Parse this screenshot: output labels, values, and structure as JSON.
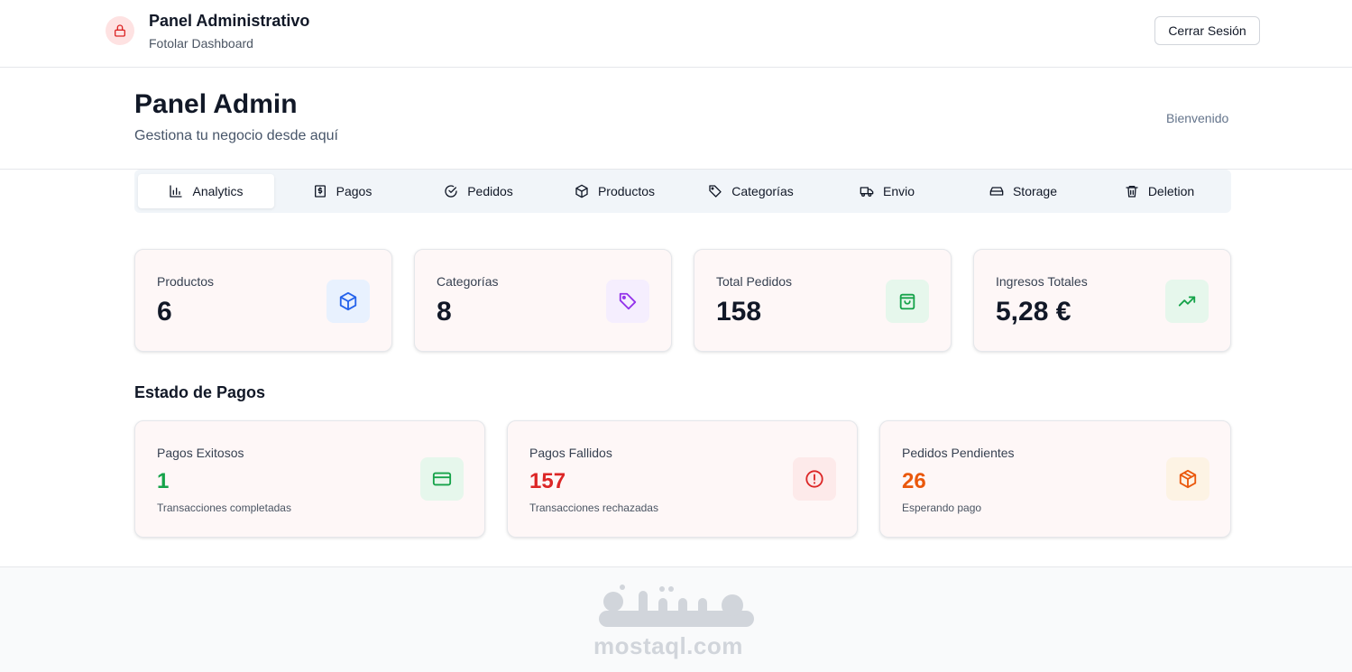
{
  "header": {
    "title": "Panel Administrativo",
    "subtitle": "Fotolar Dashboard",
    "logout_label": "Cerrar Sesión"
  },
  "page": {
    "title": "Panel Admin",
    "subtitle": "Gestiona tu negocio desde aquí",
    "welcome": "Bienvenido"
  },
  "tabs": [
    {
      "label": "Analytics",
      "icon": "bar-chart-icon",
      "active": true
    },
    {
      "label": "Pagos",
      "icon": "receipt-icon"
    },
    {
      "label": "Pedidos",
      "icon": "check-circle-icon"
    },
    {
      "label": "Productos",
      "icon": "package-icon"
    },
    {
      "label": "Categorías",
      "icon": "tag-icon"
    },
    {
      "label": "Envio",
      "icon": "truck-icon"
    },
    {
      "label": "Storage",
      "icon": "hard-drive-icon"
    },
    {
      "label": "Deletion",
      "icon": "trash-icon"
    }
  ],
  "stats": [
    {
      "label": "Productos",
      "value": "6",
      "icon": "package-icon",
      "icon_color": "#2563eb",
      "icon_bg": "#e8f1fe"
    },
    {
      "label": "Categorías",
      "value": "8",
      "icon": "tag-icon",
      "icon_color": "#9333ea",
      "icon_bg": "#f5eefe"
    },
    {
      "label": "Total Pedidos",
      "value": "158",
      "icon": "shopping-bag-icon",
      "icon_color": "#16a34a",
      "icon_bg": "#e6f7ec"
    },
    {
      "label": "Ingresos Totales",
      "value": "5,28 €",
      "icon": "trending-up-icon",
      "icon_color": "#16a34a",
      "icon_bg": "#e6f7ec"
    }
  ],
  "payments_section": {
    "title": "Estado de Pagos",
    "cards": [
      {
        "label": "Pagos Exitosos",
        "value": "1",
        "desc": "Transacciones completadas",
        "value_color": "#16a34a",
        "icon": "credit-card-icon",
        "icon_color": "#16a34a",
        "icon_bg": "#e6f7ec"
      },
      {
        "label": "Pagos Fallidos",
        "value": "157",
        "desc": "Transacciones rechazadas",
        "value_color": "#dc2626",
        "icon": "alert-circle-icon",
        "icon_color": "#dc2626",
        "icon_bg": "#fdeaea"
      },
      {
        "label": "Pedidos Pendientes",
        "value": "26",
        "desc": "Esperando pago",
        "value_color": "#ea580c",
        "icon": "package-icon",
        "icon_color": "#ea580c",
        "icon_bg": "#fdf3e4"
      }
    ]
  },
  "footer": {
    "watermark_text": "mostaql.com",
    "watermark_logo": "مستقل"
  }
}
